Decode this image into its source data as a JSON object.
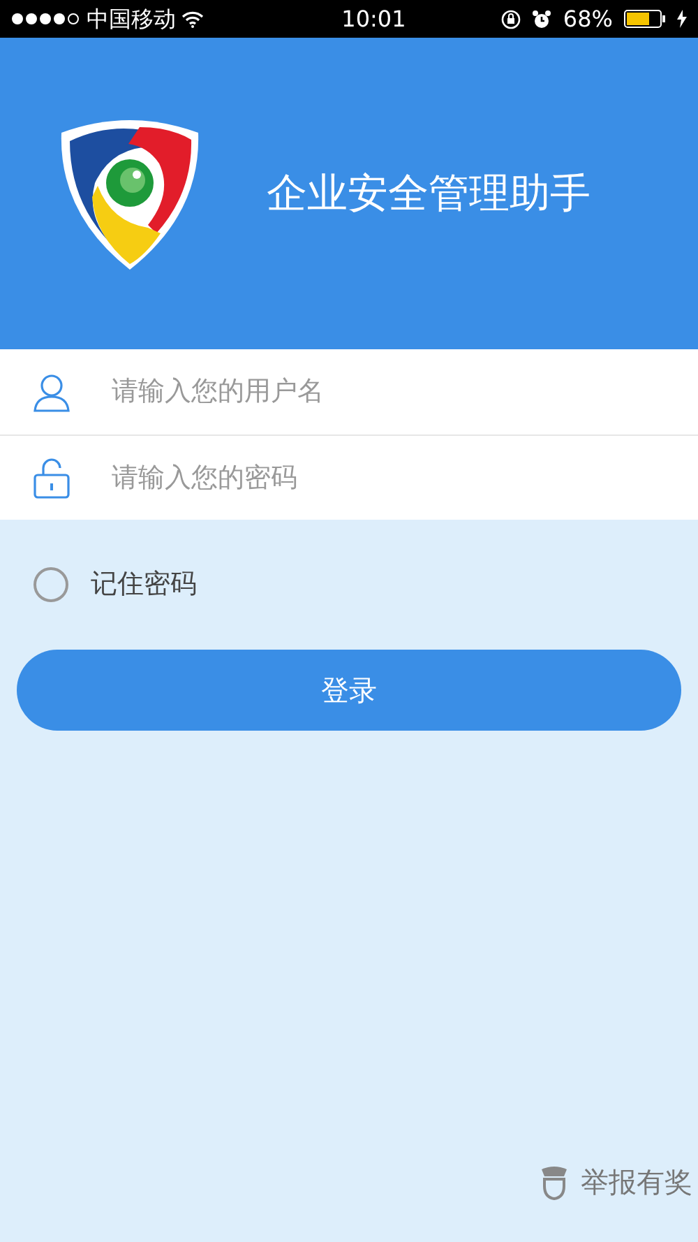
{
  "status_bar": {
    "carrier": "中国移动",
    "time": "10:01",
    "battery": "68%"
  },
  "header": {
    "title": "企业安全管理助手"
  },
  "fields": [
    {
      "kind": "user",
      "placeholder": "请输入您的用户名"
    },
    {
      "kind": "lock",
      "placeholder": "请输入您的密码"
    }
  ],
  "remember": {
    "label": "记住密码",
    "checked": false
  },
  "login_button": {
    "label": "登录"
  },
  "report": {
    "label": "举报有奖"
  }
}
